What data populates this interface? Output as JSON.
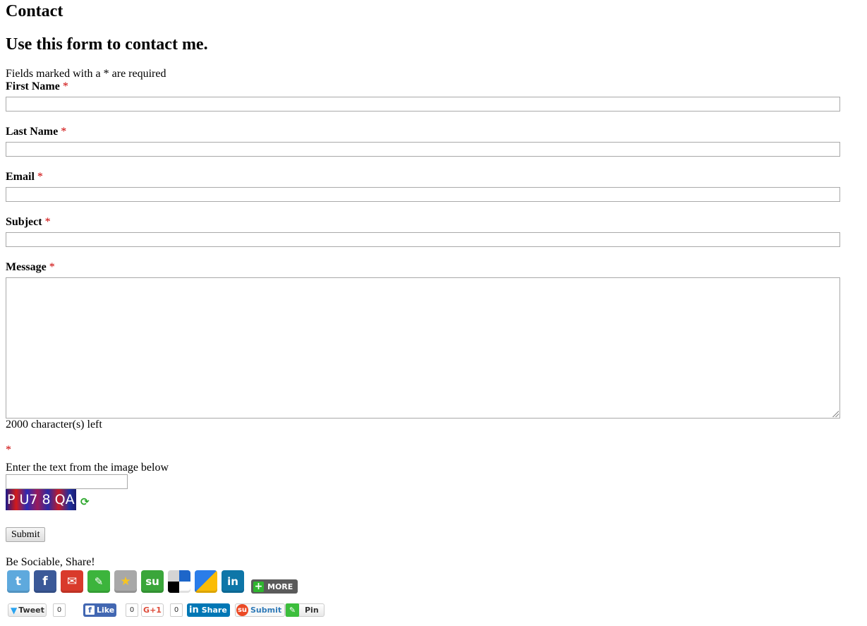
{
  "page": {
    "title": "Contact",
    "subtitle": "Use this form to contact me.",
    "required_note": "Fields marked with a * are required"
  },
  "form": {
    "required_mark": "*",
    "first_name": {
      "label": "First Name",
      "value": ""
    },
    "last_name": {
      "label": "Last Name",
      "value": ""
    },
    "email": {
      "label": "Email",
      "value": ""
    },
    "subject": {
      "label": "Subject",
      "value": ""
    },
    "message": {
      "label": "Message",
      "value": "",
      "remaining": "2000 character(s) left"
    },
    "captcha": {
      "label": "Enter the text from the image below",
      "value": "",
      "image_text": "P U7 8 QA",
      "refresh_icon": "refresh-icon"
    },
    "submit_label": "Submit"
  },
  "social": {
    "heading": "Be Sociable, Share!",
    "icons": [
      {
        "name": "twitter-icon",
        "glyph": "t",
        "color": "#5ea9dd"
      },
      {
        "name": "facebook-icon",
        "glyph": "f",
        "color": "#3b5998"
      },
      {
        "name": "email-icon",
        "glyph": "✉",
        "color": "#d93a2b"
      },
      {
        "name": "pin-icon",
        "glyph": "📌",
        "color": "#3cb43c"
      },
      {
        "name": "favorite-star-icon",
        "glyph": "★",
        "color": "#a8a8a8"
      },
      {
        "name": "stumbleupon-icon",
        "glyph": "su",
        "color": "#3aa63a"
      },
      {
        "name": "delicious-icon",
        "glyph": "",
        "color": "#ffffff"
      },
      {
        "name": "google-bookmarks-icon",
        "glyph": "",
        "color": "#ffffff"
      },
      {
        "name": "linkedin-icon",
        "glyph": "in",
        "color": "#0e76a8"
      }
    ],
    "more_label": "MORE",
    "buttons": {
      "tweet_label": "Tweet",
      "tweet_count": "0",
      "like_label": "Like",
      "like_count": "0",
      "gplus_label": "G+1",
      "gplus_count": "0",
      "linkedin_label": "Share",
      "stumble_label": "Submit",
      "pin_label": "Pin"
    }
  }
}
